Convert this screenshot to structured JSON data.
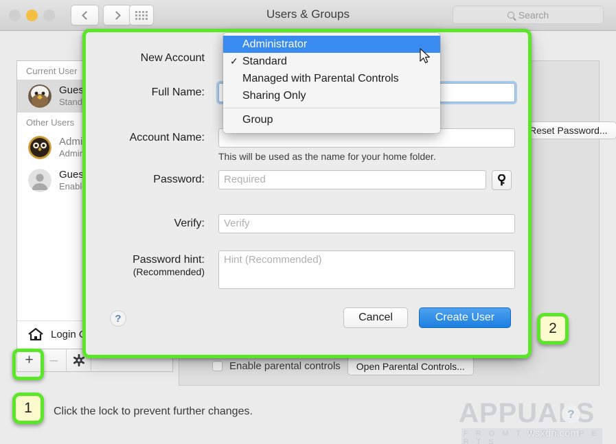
{
  "window": {
    "title": "Users & Groups",
    "search_placeholder": "Search",
    "traffic_lights": [
      "close",
      "minimize",
      "zoom"
    ],
    "nav_back": "back-icon",
    "nav_forward": "forward-icon",
    "grid_icon": "show-all-icon"
  },
  "sidebar": {
    "current_user_header": "Current User",
    "other_users_header": "Other Users",
    "current_user": {
      "name": "Guest",
      "role": "Standard"
    },
    "other_users": [
      {
        "name": "Admin",
        "role": "Admin"
      },
      {
        "name": "Guest",
        "role": "Enabled"
      }
    ],
    "login_options": "Login Options",
    "toolbar": {
      "add": "+",
      "remove": "–",
      "settings": "gear-icon"
    }
  },
  "right_panel": {
    "reset_password_label": "Reset Password...",
    "parental_checkbox_label": "Enable parental controls",
    "open_parental_controls": "Open Parental Controls..."
  },
  "footer": {
    "lock_message": "Click the lock to prevent further changes."
  },
  "dialog": {
    "new_account_label": "New Account",
    "full_name_label": "Full Name:",
    "full_name_value": "",
    "account_name_label": "Account Name:",
    "account_name_value": "",
    "account_name_helper": "This will be used as the name for your home folder.",
    "password_label": "Password:",
    "password_placeholder": "Required",
    "password_value": "",
    "key_icon": "key-icon",
    "verify_label": "Verify:",
    "verify_placeholder": "Verify",
    "verify_value": "",
    "password_hint_label": "Password hint:",
    "password_hint_sublabel": "(Recommended)",
    "password_hint_placeholder": "Hint (Recommended)",
    "password_hint_value": "",
    "help_label": "?",
    "cancel_label": "Cancel",
    "create_user_label": "Create User"
  },
  "popup_menu": {
    "items": [
      {
        "label": "Administrator",
        "checked": false,
        "highlighted": true
      },
      {
        "label": "Standard",
        "checked": true,
        "highlighted": false
      },
      {
        "label": "Managed with Parental Controls",
        "checked": false,
        "highlighted": false
      },
      {
        "label": "Sharing Only",
        "checked": false,
        "highlighted": false
      }
    ],
    "group_item": {
      "label": "Group",
      "checked": false,
      "highlighted": false
    }
  },
  "annotations": {
    "badge_one": "1",
    "badge_two": "2",
    "highlight_color": "#5ce62a"
  },
  "watermark": {
    "brand": "APPUALS",
    "tagline": "F R O M   T H E   E X P E R T S",
    "domain": "wsxdn.com"
  }
}
